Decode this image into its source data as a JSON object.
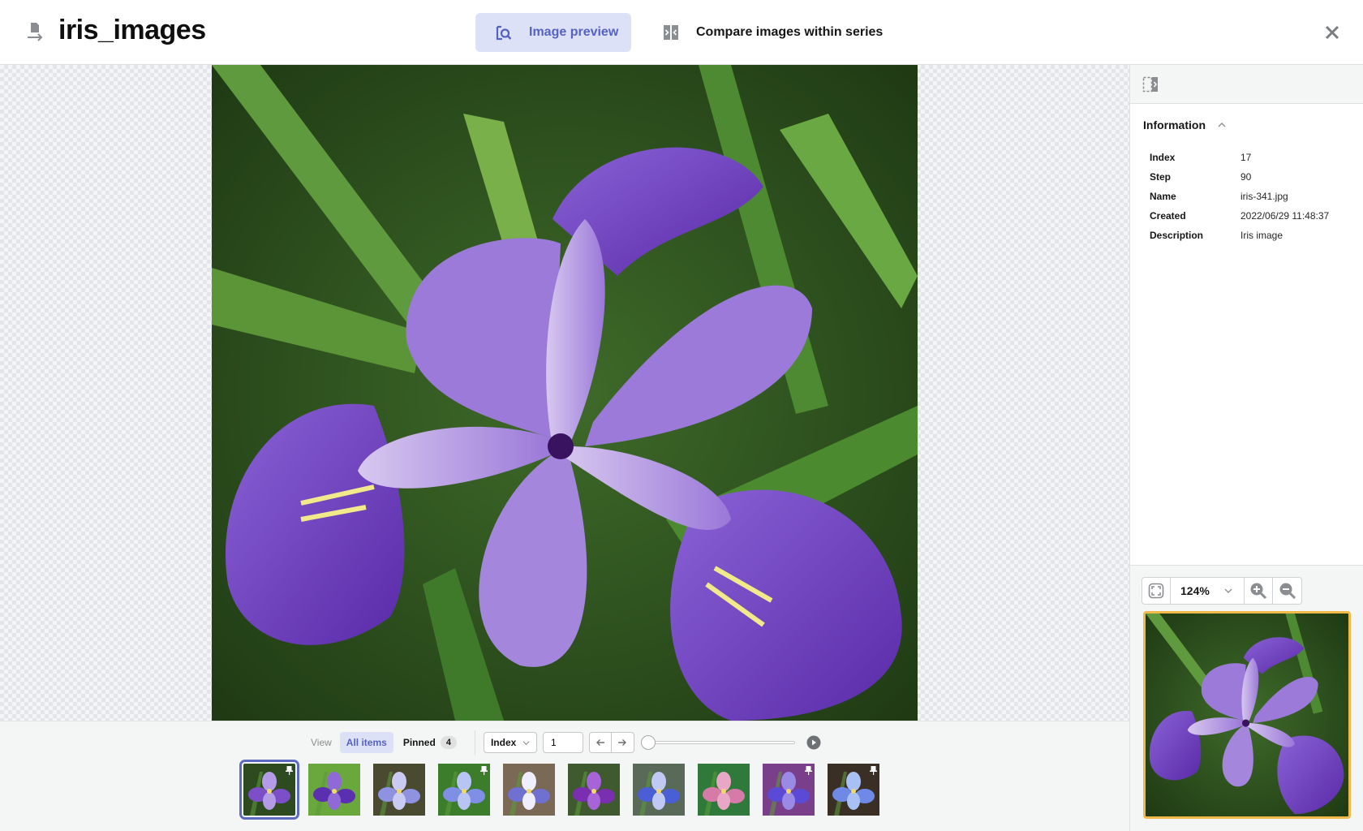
{
  "header": {
    "title": "iris_images",
    "tabs": [
      {
        "label": "Image preview",
        "icon": "image-search-icon",
        "active": true
      },
      {
        "label": "Compare images within series",
        "icon": "compare-icon",
        "active": false
      }
    ],
    "close_icon": "close-icon"
  },
  "colors": {
    "accent": "#5562c2",
    "accent_bg": "#dde1f7",
    "minimap_border": "#f0b94a",
    "selected_thumb": "#5c6bc0"
  },
  "info_panel": {
    "title": "Information",
    "rows": [
      {
        "key": "Index",
        "value": "17"
      },
      {
        "key": "Step",
        "value": "90"
      },
      {
        "key": "Name",
        "value": "iris-341.jpg"
      },
      {
        "key": "Created",
        "value": "2022/06/29 11:48:37"
      },
      {
        "key": "Description",
        "value": "Iris image"
      }
    ]
  },
  "zoom": {
    "level": "124%"
  },
  "controls": {
    "view_label": "View",
    "all_items_label": "All items",
    "pinned_label": "Pinned",
    "pinned_count": "4",
    "sort_by": "Index",
    "index_value": "1",
    "slider_position": 0
  },
  "thumbnails": [
    {
      "alt": "iris thumbnail 1",
      "pinned": true,
      "selected": true
    },
    {
      "alt": "iris thumbnail 2",
      "pinned": false,
      "selected": false
    },
    {
      "alt": "iris thumbnail 3",
      "pinned": false,
      "selected": false
    },
    {
      "alt": "iris thumbnail 4",
      "pinned": true,
      "selected": false
    },
    {
      "alt": "iris thumbnail 5",
      "pinned": false,
      "selected": false
    },
    {
      "alt": "iris thumbnail 6",
      "pinned": false,
      "selected": false
    },
    {
      "alt": "iris thumbnail 7",
      "pinned": false,
      "selected": false
    },
    {
      "alt": "iris thumbnail 8",
      "pinned": false,
      "selected": false
    },
    {
      "alt": "iris thumbnail 9",
      "pinned": true,
      "selected": false
    },
    {
      "alt": "iris thumbnail 10",
      "pinned": true,
      "selected": false
    }
  ]
}
